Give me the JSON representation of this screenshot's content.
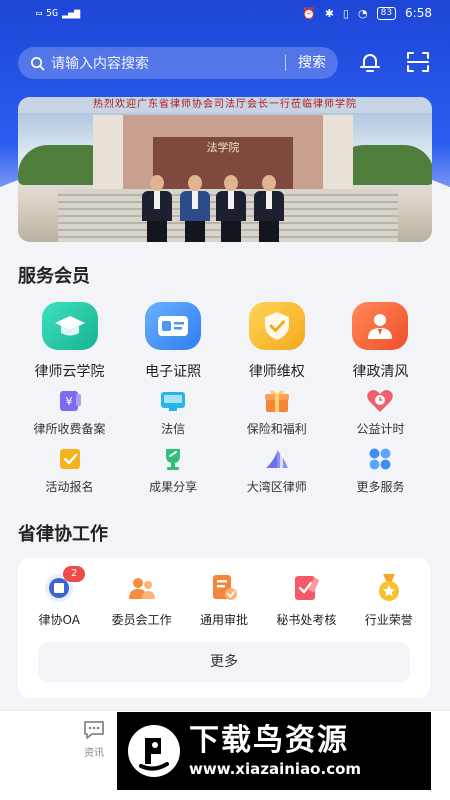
{
  "status_bar": {
    "network": "5G",
    "battery": "83",
    "time": "6:58"
  },
  "search": {
    "placeholder": "请输入内容搜索",
    "button": "搜索"
  },
  "banner": {
    "caption": "热烈欢迎广东省律师协会司法厅会长一行莅临律师学院",
    "building_sign": "法学院"
  },
  "services": {
    "title": "服务会员",
    "primary": [
      {
        "label": "律师云学院",
        "icon": "graduation-cap-icon",
        "color": "#22c3a6"
      },
      {
        "label": "电子证照",
        "icon": "id-card-icon",
        "color": "#3f8ef5"
      },
      {
        "label": "律师维权",
        "icon": "shield-check-icon",
        "color": "#f7b628"
      },
      {
        "label": "律政清风",
        "icon": "person-badge-icon",
        "color": "#f5663a"
      }
    ],
    "secondary_row1": [
      {
        "label": "律所收费备案",
        "icon": "fee-record-icon"
      },
      {
        "label": "法信",
        "icon": "faxin-icon"
      },
      {
        "label": "保险和福利",
        "icon": "gift-box-icon"
      },
      {
        "label": "公益计时",
        "icon": "heart-clock-icon"
      }
    ],
    "secondary_row2": [
      {
        "label": "活动报名",
        "icon": "signup-icon"
      },
      {
        "label": "成果分享",
        "icon": "trophy-share-icon"
      },
      {
        "label": "大湾区律师",
        "icon": "bay-area-icon"
      },
      {
        "label": "更多服务",
        "icon": "grid-more-icon"
      }
    ]
  },
  "association": {
    "title": "省律协工作",
    "items": [
      {
        "label": "律协OA",
        "icon": "oa-seal-icon",
        "badge": "2"
      },
      {
        "label": "委员会工作",
        "icon": "committee-icon"
      },
      {
        "label": "通用审批",
        "icon": "approval-icon"
      },
      {
        "label": "秘书处考核",
        "icon": "assessment-icon"
      },
      {
        "label": "行业荣誉",
        "icon": "medal-icon"
      }
    ],
    "more": "更多"
  },
  "bottom_nav": {
    "news": "资讯"
  },
  "watermark": {
    "title": "下载鸟资源",
    "url": "www.xiazainiao.com"
  }
}
